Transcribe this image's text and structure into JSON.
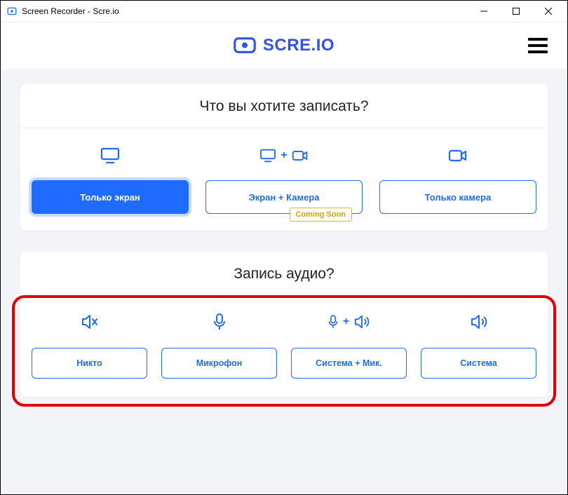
{
  "window": {
    "title": "Screen Recorder - Scre.io"
  },
  "brand": {
    "name": "SCRE.IO"
  },
  "record": {
    "title": "Что вы хотите записать?",
    "options": [
      {
        "label": "Только экран",
        "selected": true
      },
      {
        "label": "Экран + Камера",
        "badge": "Coming Soon"
      },
      {
        "label": "Только камера"
      }
    ]
  },
  "audio": {
    "title": "Запись аудио?",
    "options": [
      {
        "label": "Никто"
      },
      {
        "label": "Микрофон"
      },
      {
        "label": "Система + Мик."
      },
      {
        "label": "Система"
      }
    ]
  }
}
